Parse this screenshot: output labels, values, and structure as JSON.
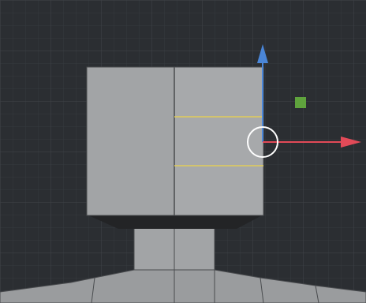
{
  "viewport": {
    "background": "#2b2e32",
    "grid": true,
    "grid_minor_color": "#363a3f",
    "grid_major_color": "#404449"
  },
  "mesh": {
    "face_light": "#a2a4a6",
    "face_shade": "#9a9c9e",
    "shadow": "#232426",
    "edge": "#4a4c4f",
    "selected_edge_loop_color": "#e1cc5a",
    "selected_edge_loops": 2
  },
  "gizmo": {
    "x_axis_color": "#e24a58",
    "z_axis_color": "#4a86d8",
    "plane_handle_color": "#5fa33d",
    "pivot_ring_color": "#ffffff",
    "x_axis_icon": "arrow-right-icon",
    "z_axis_icon": "arrow-up-icon"
  }
}
